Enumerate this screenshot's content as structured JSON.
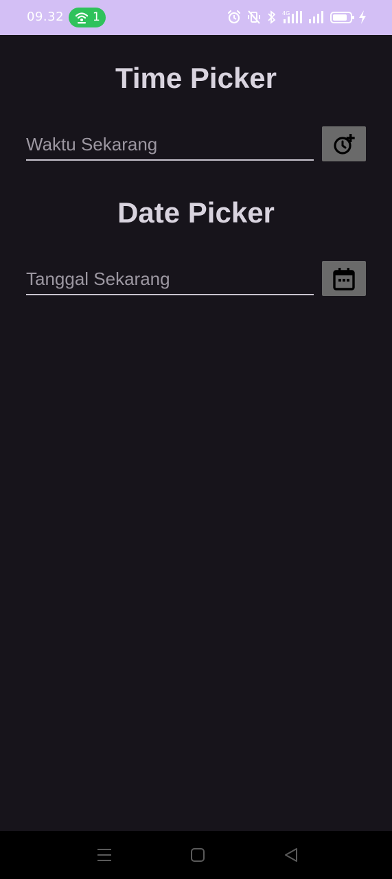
{
  "status_bar": {
    "time": "09.32",
    "hotspot_count": "1",
    "background_color": "#d3bff5",
    "hotspot_color": "#2fc25b",
    "icons": [
      "wifi-hotspot-icon",
      "alarm-icon",
      "vibrate-off-icon",
      "bluetooth-icon",
      "signal-4g-icon",
      "signal-icon",
      "battery-icon",
      "charging-icon"
    ]
  },
  "time_picker": {
    "title": "Time Picker",
    "placeholder": "Waktu Sekarang",
    "value": "",
    "button_icon": "clock-add-icon"
  },
  "date_picker": {
    "title": "Date Picker",
    "placeholder": "Tanggal Sekarang",
    "value": "",
    "button_icon": "calendar-icon"
  },
  "nav_bar": {
    "icons": [
      "menu-icon",
      "home-icon",
      "back-icon"
    ]
  },
  "colors": {
    "background": "#17141b",
    "title_text": "#d9d4df",
    "placeholder_text": "#9c97a1",
    "button_background": "#6a6a6a"
  }
}
